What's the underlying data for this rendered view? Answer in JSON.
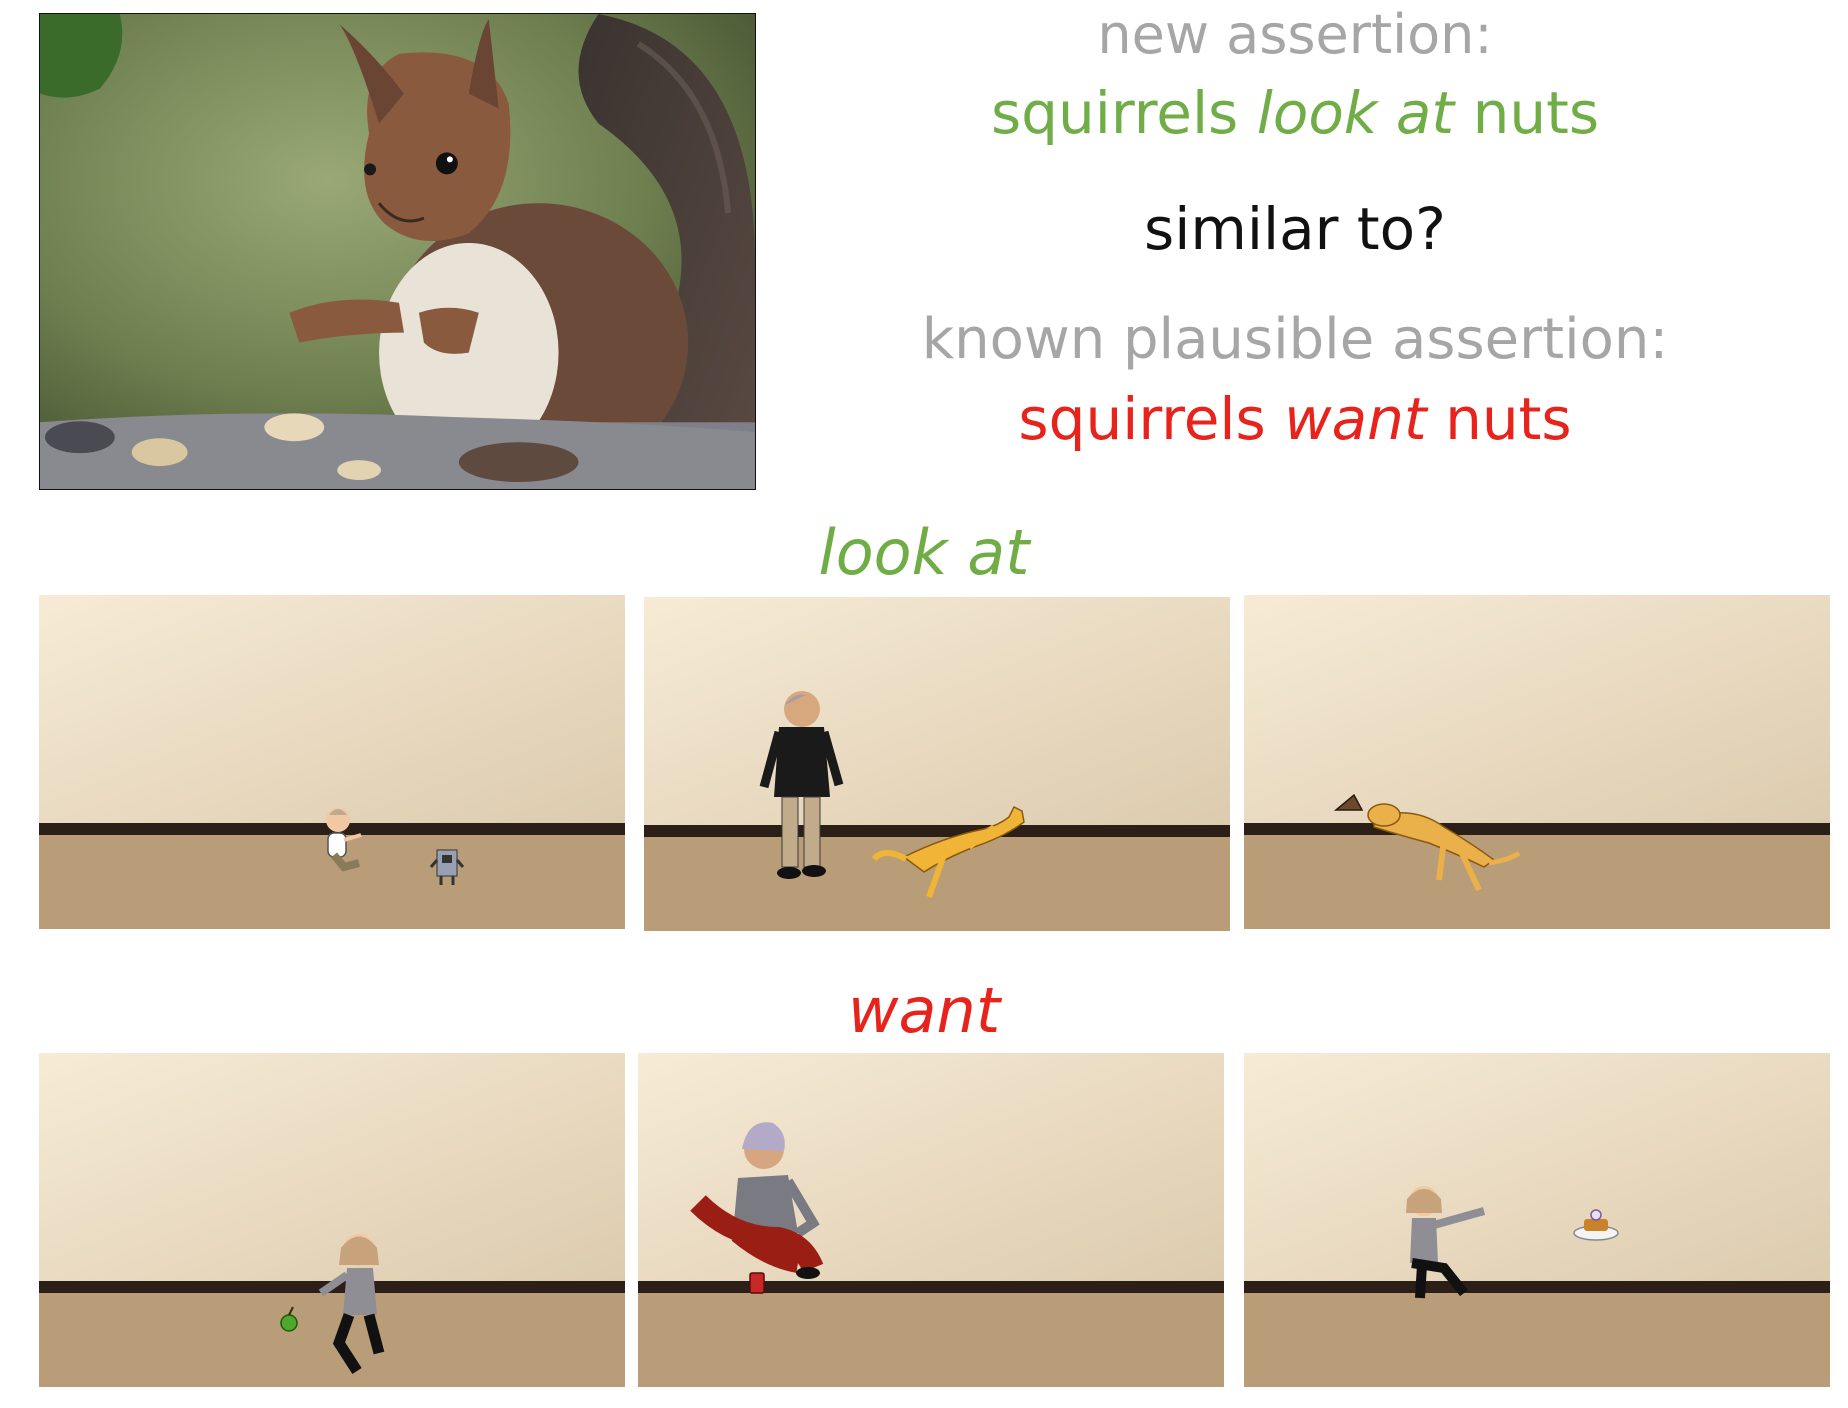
{
  "photo": {
    "subject": "red squirrel with nut shells"
  },
  "assertions": {
    "new_label": "new assertion:",
    "new_statement": {
      "subject": "squirrels",
      "relation": "look at",
      "object": "nuts"
    },
    "question": "similar to?",
    "known_label": "known plausible assertion:",
    "known_statement": {
      "subject": "squirrels",
      "relation": "want",
      "object": "nuts"
    }
  },
  "sections": [
    {
      "heading": "look at",
      "color": "#70ad47",
      "scenes": [
        "baby looking at toy robot",
        "man looking at leaping cat",
        "dog leaping toward wedge"
      ]
    },
    {
      "heading": "want",
      "color": "#e8231c",
      "scenes": [
        "girl reaching for apple",
        "woman reaching for can",
        "girl reaching for cake"
      ]
    }
  ],
  "colors": {
    "green": "#70ad47",
    "red": "#e8231c",
    "gray": "#a6a6a6"
  }
}
